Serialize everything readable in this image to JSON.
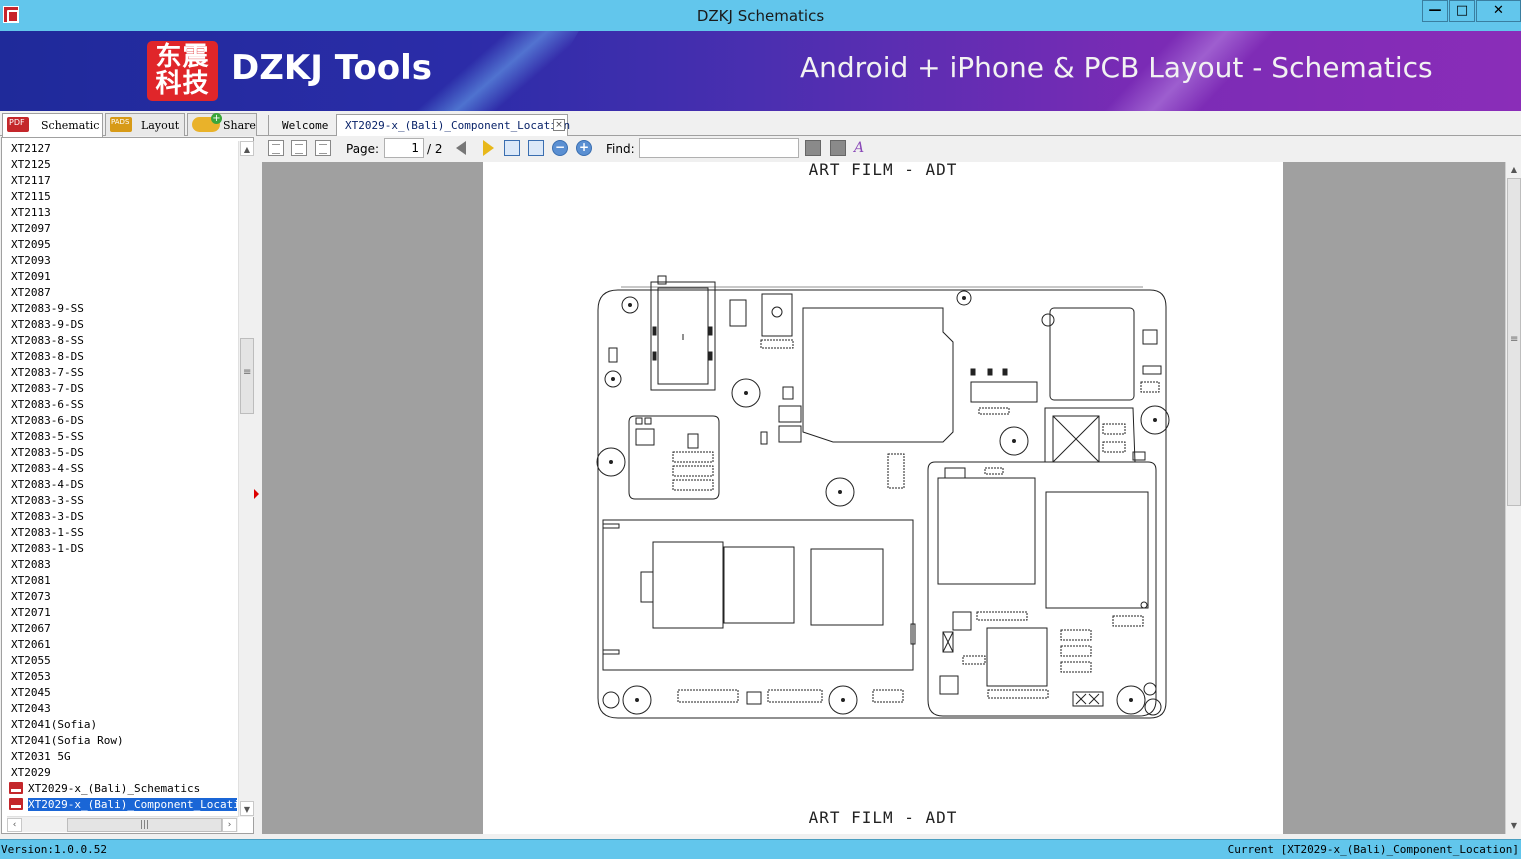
{
  "window": {
    "title": "DZKJ Schematics",
    "controls": {
      "minimize": "—",
      "maximize": "□",
      "close": "✕"
    }
  },
  "banner": {
    "logo_line1": "东震",
    "logo_line2": "科技",
    "brand": "DZKJ Tools",
    "tagline": "Android + iPhone & PCB Layout - Schematics"
  },
  "left_tabs": [
    {
      "label": "Schematic",
      "icon": "pdf-icon",
      "active": true
    },
    {
      "label": "Layout",
      "icon": "pads-icon",
      "active": false
    },
    {
      "label": "Share",
      "icon": "cloud-share-icon",
      "active": false
    }
  ],
  "doc_tabs": {
    "welcome": "Welcome",
    "current": "XT2029-x_(Bali)_Component_Location",
    "close_glyph": "×"
  },
  "sidebar": {
    "items": [
      "XT2127",
      "XT2125",
      "XT2117",
      "XT2115",
      "XT2113",
      "XT2097",
      "XT2095",
      "XT2093",
      "XT2091",
      "XT2087",
      "XT2083-9-SS",
      "XT2083-9-DS",
      "XT2083-8-SS",
      "XT2083-8-DS",
      "XT2083-7-SS",
      "XT2083-7-DS",
      "XT2083-6-SS",
      "XT2083-6-DS",
      "XT2083-5-SS",
      "XT2083-5-DS",
      "XT2083-4-SS",
      "XT2083-4-DS",
      "XT2083-3-SS",
      "XT2083-3-DS",
      "XT2083-1-SS",
      "XT2083-1-DS",
      "XT2083",
      "XT2081",
      "XT2073",
      "XT2071",
      "XT2067",
      "XT2061",
      "XT2055",
      "XT2053",
      "XT2045",
      "XT2043",
      "XT2041(Sofia)",
      "XT2041(Sofia Row)",
      "XT2031 5G",
      "XT2029"
    ],
    "files": [
      {
        "label": "XT2029-x_(Bali)_Schematics",
        "selected": false
      },
      {
        "label": "XT2029-x_(Bali)_Component_Location",
        "selected": true
      }
    ]
  },
  "toolbar": {
    "page_label": "Page:",
    "page_value": "1",
    "page_total": "/ 2",
    "find_label": "Find:",
    "find_value": "",
    "zoom_out": "−",
    "zoom_in": "+",
    "highlight_glyph": "A"
  },
  "document": {
    "header_text": "ART FILM - ADT",
    "footer_text": "ART FILM - ADT"
  },
  "status": {
    "version": "Version:1.0.0.52",
    "current": "Current [XT2029-x_(Bali)_Component_Location]"
  },
  "colors": {
    "titlebar": "#62c6ec",
    "selection": "#1a66d6",
    "banner_start": "#1f2a9a",
    "banner_end": "#8a2db8",
    "logo_red": "#e0262a"
  }
}
